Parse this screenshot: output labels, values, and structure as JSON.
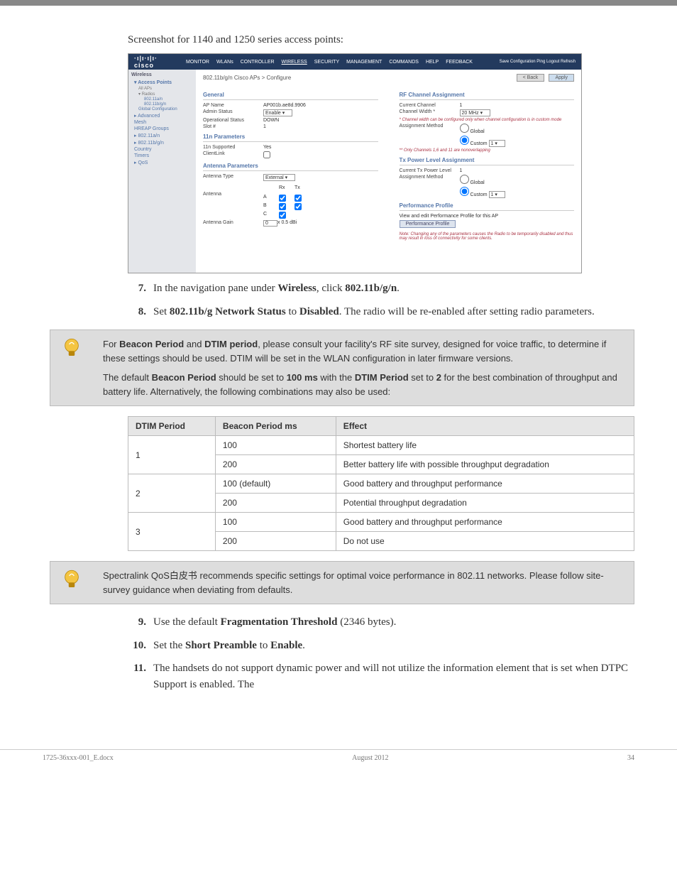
{
  "caption_1140": "Screenshot for 1140 and 1250 series access points:",
  "screenshot": {
    "logo": "cisco",
    "top_right": "Save Configuration   Ping   Logout   Refresh",
    "nav": [
      "MONITOR",
      "WLANs",
      "CONTROLLER",
      "WIRELESS",
      "SECURITY",
      "MANAGEMENT",
      "COMMANDS",
      "HELP",
      "FEEDBACK"
    ],
    "left_panel_title": "Wireless",
    "left_items": {
      "ap_head": "Access Points",
      "all_aps": "All APs",
      "radios": "Radios",
      "r1": "802.11a/n",
      "r2": "802.11b/g/n",
      "global": "Global Configuration",
      "advanced": "Advanced",
      "mesh": "Mesh",
      "hreap": "HREAP Groups",
      "an": "802.11a/n",
      "bgn": "802.11b/g/n",
      "country": "Country",
      "timers": "Timers",
      "qos": "QoS"
    },
    "page_title": "802.11b/g/n Cisco APs > Configure",
    "btn_back": "< Back",
    "btn_apply": "Apply",
    "general": {
      "title": "General",
      "ap_name_l": "AP Name",
      "ap_name_v": "AP001b.ae8d.9906",
      "admin_l": "Admin Status",
      "admin_v": "Enable",
      "oper_l": "Operational Status",
      "oper_v": "DOWN",
      "slot_l": "Slot #",
      "slot_v": "1"
    },
    "n_params": {
      "title": "11n Parameters",
      "sup_l": "11n Supported",
      "sup_v": "Yes",
      "cl_l": "ClientLink"
    },
    "antenna": {
      "title": "Antenna Parameters",
      "type_l": "Antenna Type",
      "type_v": "External",
      "rx": "Rx",
      "tx": "Tx",
      "ant_l": "Antenna",
      "a": "A",
      "b": "B",
      "c": "C",
      "gain_l": "Antenna Gain",
      "gain_v": "0",
      "gain_unit": "x 0.5 dBi"
    },
    "rf": {
      "title": "RF Channel Assignment",
      "cur_l": "Current Channel",
      "cur_v": "1",
      "width_l": "Channel Width *",
      "width_v": "20 MHz",
      "note1": "* Channel width can be configured only when channel configuration is in custom mode",
      "assign_l": "Assignment Method",
      "global": "Global",
      "custom": "Custom",
      "custom_v": "1",
      "note2": "** Only Channels 1,6 and 11 are nonoverlapping"
    },
    "tx": {
      "title": "Tx Power Level Assignment",
      "cur_l": "Current Tx Power Level",
      "cur_v": "1",
      "assign_l": "Assignment Method",
      "global": "Global",
      "custom": "Custom",
      "custom_v": "1"
    },
    "perf": {
      "title": "Performance Profile",
      "view": "View and edit Performance Profile for this AP",
      "btn": "Performance Profile"
    },
    "bottom_note": "Note: Changing any of the parameters causes the Radio to be temporarily disabled and thus may result in loss of connectivity for some clients."
  },
  "step7": {
    "num": "7.",
    "pre": "In the navigation pane under ",
    "link1": "Wireless",
    "mid": ", click ",
    "link2": "802.11b/g/n",
    "end": "."
  },
  "step8": {
    "num": "8.",
    "pre": "Set ",
    "bold1": "802.11b/g Network Status",
    "mid": " to ",
    "bold2": "Disabled",
    "end": ". The radio will be re-enabled after setting radio parameters."
  },
  "note1": {
    "pre": "For ",
    "bold1": "Beacon Period",
    "mid": " and ",
    "bold2": "DTIM period",
    "after": ", please consult your facility's RF site survey, designed for voice traffic, to determine if these settings should be used. DTIM will be set in the WLAN configuration in later firmware versions.",
    "p2_pre": "The default ",
    "p2_b1": "Beacon Period",
    "p2_mid": " should be set to ",
    "p2_b2": "100 ms",
    "p2_mid2": " with the ",
    "p2_b3": "DTIM Period",
    "p2_mid3": " set to ",
    "p2_b4": "2",
    "p2_end": " for the best combination of throughput and battery life. Alternatively, the following combinations may also be used:"
  },
  "table": {
    "head_dtim": "DTIM Period",
    "head_beacon": "Beacon Period ms",
    "head_effect": "Effect",
    "r1_d": "1",
    "r1_b": "100",
    "r1_e": "Shortest battery life",
    "r2_b": "200",
    "r2_e": "Better battery life with possible throughput degradation",
    "r3_d": "2",
    "r3_b": "100 (default)",
    "r3_e": "Good battery and throughput performance",
    "r4_b": "200",
    "r4_e": "Potential throughput degradation",
    "r5_d": "3",
    "r5_b": "100",
    "r5_e": "Good battery and throughput performance",
    "r6_b": "200",
    "r6_e": "Do not use"
  },
  "note2": {
    "text": "Spectralink QoS白皮书 recommends specific settings for optimal voice performance in 802.11 networks. Please follow site-survey guidance when deviating from defaults."
  },
  "step9": {
    "num": "9.",
    "pre": "Use the default ",
    "bold": "Fragmentation Threshold",
    "end": " (2346 bytes)."
  },
  "step10": {
    "num": "10.",
    "pre": "Set the ",
    "bold": "Short Preamble",
    "mid": " to ",
    "bold2": "Enable",
    "end": "."
  },
  "step11": {
    "num": "11.",
    "text": "The handsets do not support dynamic power and will not utilize the information element that is set when DTPC Support is enabled. The"
  },
  "footer": {
    "left": "1725-36xxx-001_E.docx",
    "center": "August 2012",
    "right": "34"
  }
}
